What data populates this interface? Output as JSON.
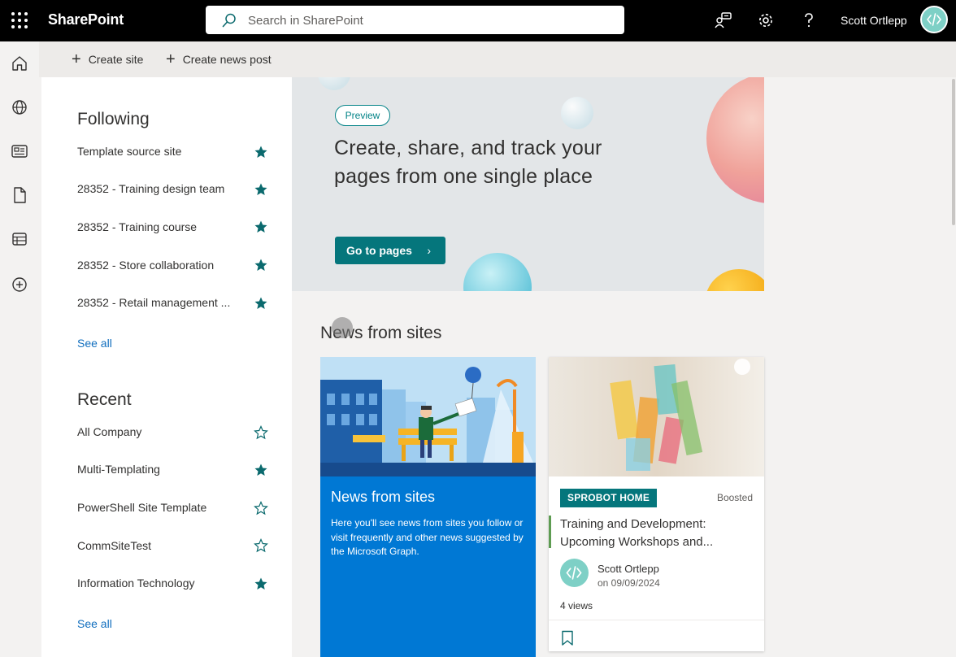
{
  "app": {
    "title": "SharePoint",
    "search_placeholder": "Search in SharePoint",
    "user_name": "Scott Ortlepp"
  },
  "icons": {
    "waffle": "app-launcher-icon",
    "feedback": "feedback-icon",
    "settings": "gear-icon",
    "help": "help-icon",
    "rail": [
      "home-icon",
      "globe-icon",
      "news-icon",
      "file-icon",
      "list-icon",
      "add-icon"
    ]
  },
  "commands": {
    "create_site": "Create site",
    "create_news": "Create news post"
  },
  "following": {
    "heading": "Following",
    "items": [
      {
        "label": "Template source site",
        "starred": true
      },
      {
        "label": "28352 - Training design team",
        "starred": true
      },
      {
        "label": "28352 - Training course",
        "starred": true
      },
      {
        "label": "28352 - Store collaboration",
        "starred": true
      },
      {
        "label": "28352 - Retail management ...",
        "starred": true
      }
    ],
    "see_all": "See all"
  },
  "recent": {
    "heading": "Recent",
    "items": [
      {
        "label": "All Company",
        "starred": false
      },
      {
        "label": "Multi-Templating",
        "starred": true
      },
      {
        "label": "PowerShell Site Template",
        "starred": false
      },
      {
        "label": "CommSiteTest",
        "starred": false
      },
      {
        "label": "Information Technology",
        "starred": true
      }
    ],
    "see_all": "See all"
  },
  "hero": {
    "badge": "Preview",
    "title": "Create, share, and track your pages from one single place",
    "button": "Go to pages"
  },
  "news": {
    "heading": "News from sites",
    "promo": {
      "title": "News from sites",
      "description": "Here you'll see news from sites you follow or visit frequently and other news suggested by the Microsoft Graph."
    },
    "article": {
      "tag": "SPROBOT HOME",
      "boosted": "Boosted",
      "title": "Training and Development: Upcoming Workshops and...",
      "author": "Scott Ortlepp",
      "date": "on 09/09/2024",
      "views": "4 views"
    }
  },
  "colors": {
    "accent": "#05767c",
    "link": "#106ebe",
    "promo_blue": "#0078d4",
    "star": "#0b6a6e"
  }
}
